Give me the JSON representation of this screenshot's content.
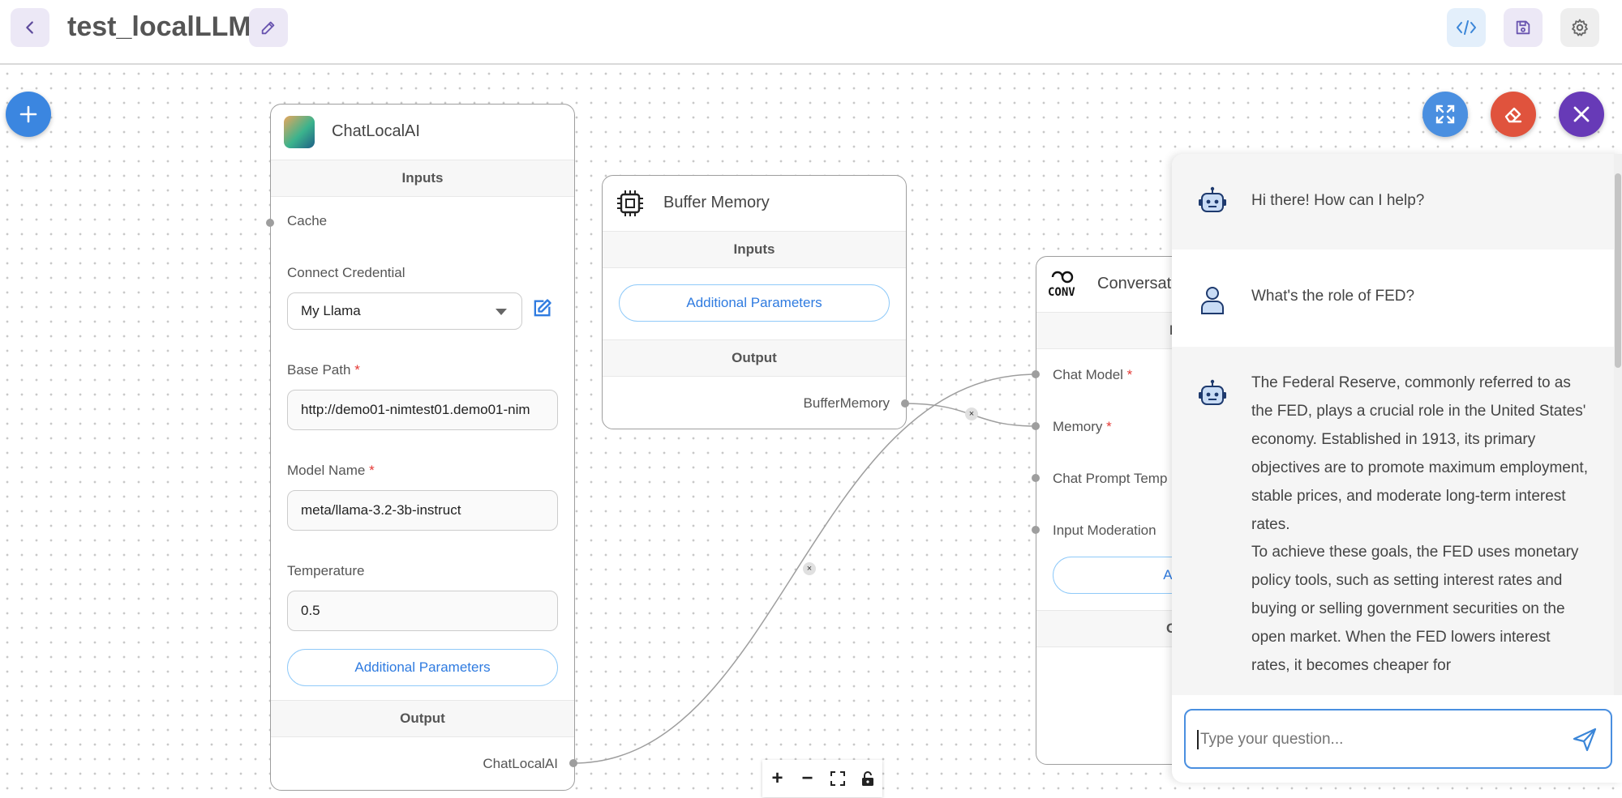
{
  "header": {
    "title": "test_localLLM",
    "back_icon": "chevron-left-icon",
    "edit_icon": "pencil-icon",
    "code_icon": "code-icon",
    "save_icon": "save-icon",
    "settings_icon": "gear-icon"
  },
  "colors": {
    "accent": "#4a8fe0",
    "danger": "#e0533d",
    "purple": "#673ab7",
    "required": "#e53935"
  },
  "canvas": {
    "add_icon": "plus-icon",
    "expand_icon": "expand-icon",
    "clear_icon": "eraser-icon",
    "close_icon": "close-icon"
  },
  "node_chatlocalai": {
    "title": "ChatLocalAI",
    "inputs_label": "Inputs",
    "cache_label": "Cache",
    "credential_label": "Connect Credential",
    "credential_value": "My Llama",
    "base_path_label": "Base Path",
    "base_path_value": "http://demo01-nimtest01.demo01-nim",
    "model_name_label": "Model Name",
    "model_name_value": "meta/llama-3.2-3b-instruct",
    "temperature_label": "Temperature",
    "temperature_value": "0.5",
    "additional_params": "Additional Parameters",
    "output_label": "Output",
    "output_value": "ChatLocalAI",
    "required_mark": "*"
  },
  "node_buffer": {
    "title": "Buffer Memory",
    "inputs_label": "Inputs",
    "additional_params": "Additional Parameters",
    "output_label": "Output",
    "output_value": "BufferMemory"
  },
  "node_conv": {
    "icon_text": "CONV",
    "title": "Conversat",
    "input_heading": "I",
    "chat_model_label": "Chat Model",
    "memory_label": "Memory",
    "chat_prompt_label": "Chat Prompt Temp",
    "input_moderation_label": "Input Moderation",
    "additional_params": "Addition",
    "output_heading": "C",
    "required_mark": "*"
  },
  "chat": {
    "messages": [
      {
        "role": "bot",
        "text": "Hi there! How can I help?"
      },
      {
        "role": "user",
        "text": "What's the role of FED?"
      },
      {
        "role": "bot",
        "text": "The Federal Reserve, commonly referred to as the FED, plays a crucial role in the United States' economy. Established in 1913, its primary objectives are to promote maximum employment, stable prices, and moderate long-term interest rates."
      },
      {
        "role": "bot-cont",
        "text": "To achieve these goals, the FED uses monetary policy tools, such as setting interest rates and buying or selling government securities on the open market. When the FED lowers interest rates, it becomes cheaper for"
      }
    ],
    "input_placeholder": "Type your question...",
    "send_icon": "send-icon"
  },
  "zoom_controls": {
    "zoom_in": "+",
    "zoom_out": "−",
    "fit_icon": "fit-view-icon",
    "lock_icon": "lock-icon"
  }
}
